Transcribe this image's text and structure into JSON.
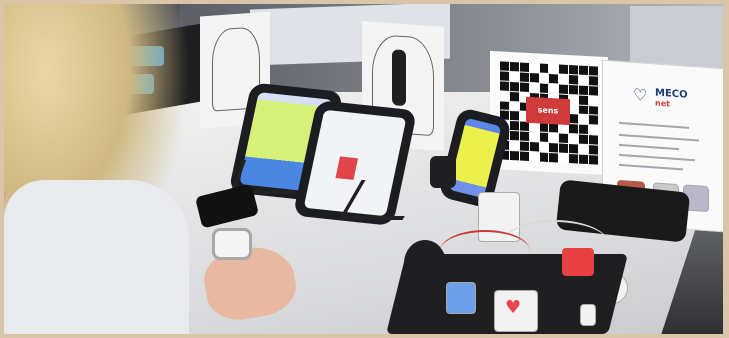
{
  "scene": {
    "description_free": true,
    "colors": {
      "frame": "#d9c6a8",
      "table": "#e9eaec",
      "screen_yellow": "#d6f07a",
      "screen_blue": "#4b86e0",
      "red_device": "#e84141"
    }
  },
  "qr_sign": {
    "logo_text": "sens"
  },
  "product_sign": {
    "brand_line1": "MECO",
    "brand_line2": "net"
  },
  "icons": [
    "heart-icon",
    "qr-code",
    "tablet",
    "phone",
    "watch"
  ]
}
